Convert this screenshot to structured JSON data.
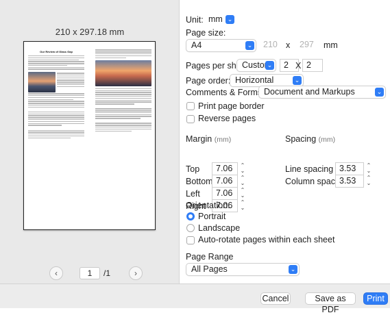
{
  "preview": {
    "dimensions": "210 x 297.18 mm",
    "doc_title": "Our Review of Glass Gap",
    "current_page": "1",
    "total_pages": "/1",
    "prev_icon": "chevron-left",
    "next_icon": "chevron-right"
  },
  "unit": {
    "label": "Unit:",
    "value": "mm"
  },
  "page_size": {
    "label": "Page size:",
    "value": "A4",
    "width": "210",
    "x1": "x",
    "height": "297",
    "unit": "mm"
  },
  "pages_per_sheet": {
    "label": "Pages per sheet:",
    "value": "Custom",
    "cols": "2",
    "x": "X",
    "rows": "2"
  },
  "page_order": {
    "label": "Page order:",
    "value": "Horizontal"
  },
  "comments_forms": {
    "label": "Comments & Forms:",
    "value": "Document and Markups"
  },
  "options": {
    "print_border": "Print page border",
    "reverse_pages": "Reverse pages"
  },
  "margin": {
    "label": "Margin",
    "unit": "(mm)",
    "top_label": "Top",
    "top": "7.06",
    "bottom_label": "Bottom",
    "bottom": "7.06",
    "left_label": "Left",
    "left": "7.06",
    "right_label": "Right",
    "right": "7.06"
  },
  "spacing": {
    "label": "Spacing",
    "unit": "(mm)",
    "line_label": "Line spacing",
    "line": "3.53",
    "column_label": "Column spacing",
    "column": "3.53"
  },
  "orientation": {
    "label": "Orientation:",
    "portrait": "Portrait",
    "landscape": "Landscape",
    "selected": "Portrait",
    "auto_rotate": "Auto-rotate pages within each sheet"
  },
  "page_range": {
    "label": "Page Range",
    "value": "All Pages"
  },
  "footer": {
    "cancel": "Cancel",
    "save_pdf": "Save as PDF",
    "print": "Print"
  },
  "colors": {
    "accent": "#2f7df6",
    "preview_bg": "#e9e9e9",
    "footer_bg": "#ececec"
  }
}
